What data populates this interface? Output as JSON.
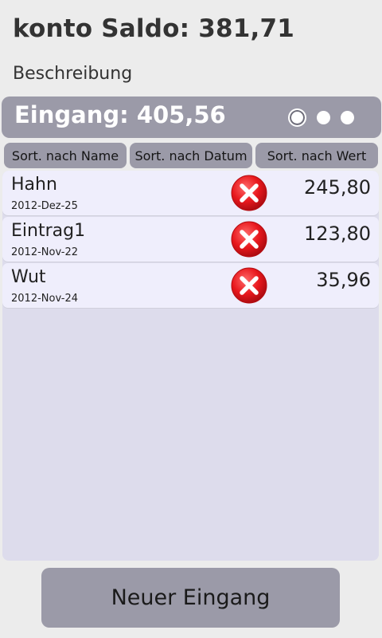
{
  "header": {
    "title": "konto Saldo: 381,71",
    "description": "Beschreibung"
  },
  "section": {
    "title": "Eingang: 405,56",
    "pager": {
      "pages": 3,
      "active_index": 0
    }
  },
  "sort": {
    "by_name": "Sort. nach Name",
    "by_date": "Sort. nach Datum",
    "by_value": "Sort. nach Wert"
  },
  "entries": [
    {
      "name": "Hahn",
      "date": "2012-Dez-25",
      "value": "245,80"
    },
    {
      "name": "Eintrag1",
      "date": "2012-Nov-22",
      "value": "123,80"
    },
    {
      "name": "Wut",
      "date": "2012-Nov-24",
      "value": "35,96"
    }
  ],
  "actions": {
    "new_entry": "Neuer Eingang"
  },
  "icons": {
    "delete": "delete-x-icon"
  },
  "colors": {
    "background": "#ececec",
    "bar": "#9b9aa8",
    "list_background": "#dddcec",
    "row_background": "#efeefc",
    "delete_red": "#e8181d"
  }
}
